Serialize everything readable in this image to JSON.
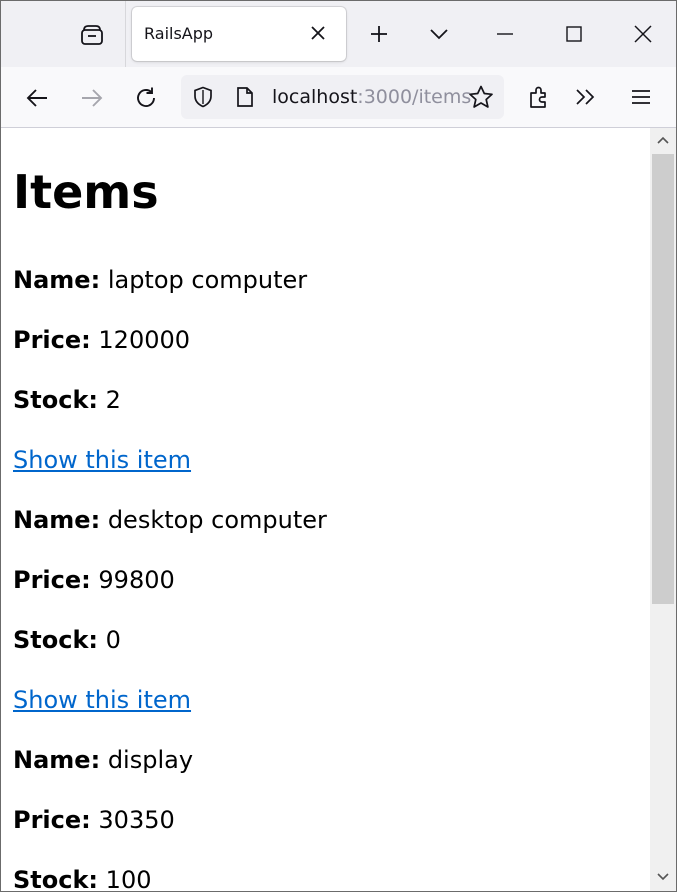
{
  "browser": {
    "tab": {
      "title": "RailsApp"
    },
    "url": {
      "host": "localhost",
      "rest": ":3000/items"
    }
  },
  "page": {
    "title": "Items",
    "items": [
      {
        "name_label": "Name:",
        "name": "laptop computer",
        "price_label": "Price:",
        "price": "120000",
        "stock_label": "Stock:",
        "stock": "2",
        "link": "Show this item"
      },
      {
        "name_label": "Name:",
        "name": "desktop computer",
        "price_label": "Price:",
        "price": "99800",
        "stock_label": "Stock:",
        "stock": "0",
        "link": "Show this item"
      },
      {
        "name_label": "Name:",
        "name": "display",
        "price_label": "Price:",
        "price": "30350",
        "stock_label": "Stock:",
        "stock": "100"
      }
    ]
  },
  "colors": {
    "link": "#0066cc",
    "tabstrip_bg": "#f0f0f4",
    "navbar_bg": "#f9f9fb"
  }
}
